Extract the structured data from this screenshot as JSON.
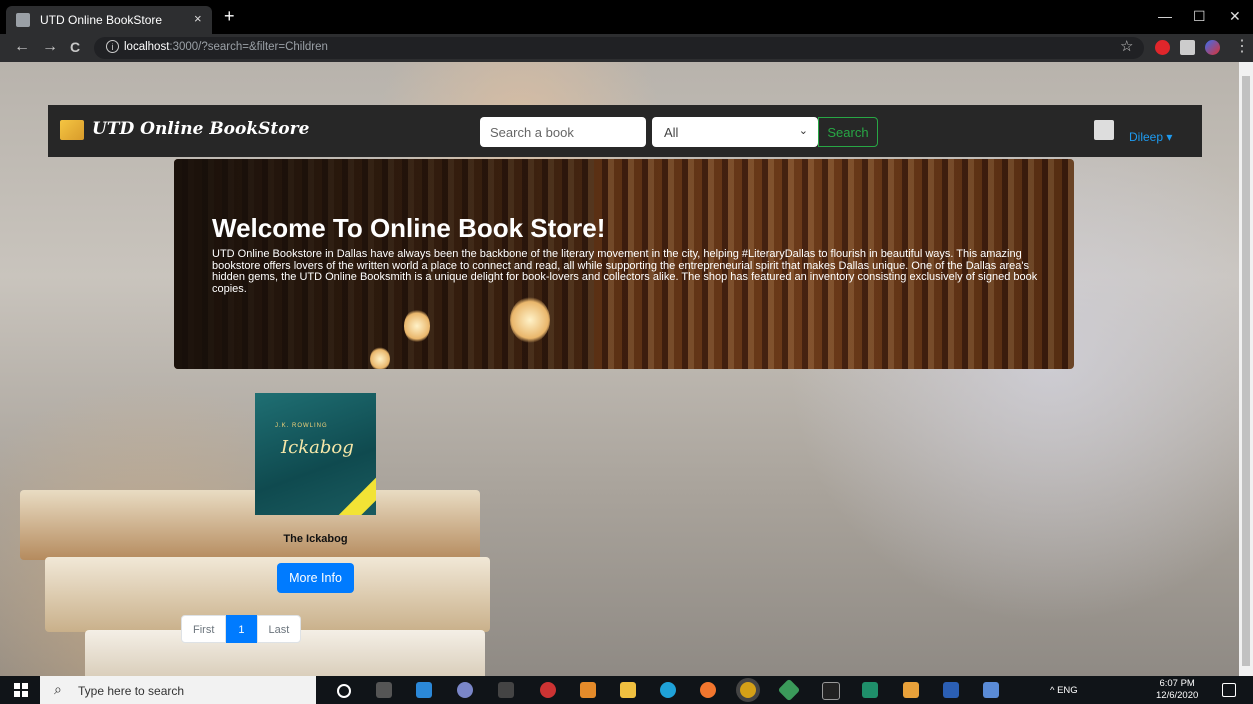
{
  "browser": {
    "tab_title": "UTD Online BookStore",
    "tab_close": "×",
    "new_tab": "+",
    "url_host": "localhost",
    "url_rest": ":3000/?search=&filter=Children",
    "back_icon": "←",
    "forward_icon": "→",
    "reload_icon": "C",
    "info_icon": "i",
    "minimize_icon": "—",
    "maximize_icon": "☐",
    "close_icon": "✕",
    "star_icon": "☆",
    "menu_icon": "⋮"
  },
  "navbar": {
    "brand": "UTD Online BookStore",
    "search_placeholder": "Search a book",
    "filter_value": "All",
    "filter_chevron": "⌄",
    "search_button": "Search",
    "user_name": "Dileep ▾"
  },
  "hero": {
    "title": "Welcome To Online Book Store!",
    "text": "UTD Online Bookstore in Dallas have always been the backbone of the literary movement in the city, helping #LiteraryDallas to flourish in beautiful ways. This amazing bookstore offers lovers of the written world a place to connect and read, all while supporting the entrepreneurial spirit that makes Dallas unique. One of the Dallas area's hidden gems, the UTD Online Booksmith is a unique delight for book-lovers and collectors alike. The shop has featured an inventory consisting exclusively of signed book copies."
  },
  "book": {
    "cover_author": "J.K. ROWLING",
    "cover_title": "Ickabog",
    "title": "The Ickabog",
    "more_info": "More Info"
  },
  "pagination": {
    "first": "First",
    "current": "1",
    "last": "Last"
  },
  "taskbar": {
    "search_icon": "⌕",
    "search_placeholder": "Type here to search",
    "tray_text": "^   ENG",
    "time": "6:07 PM",
    "date": "12/6/2020"
  },
  "colors": {
    "primary": "#007bff",
    "success": "#28a745",
    "navbar": "#272727",
    "user_link": "#1e9bf0"
  }
}
